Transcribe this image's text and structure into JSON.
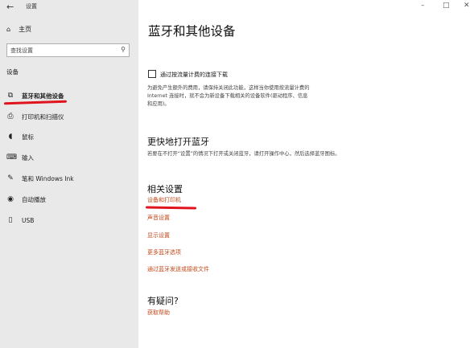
{
  "titlebar": {
    "back_icon": "back-arrow-icon",
    "title": "设置",
    "minimize": "–",
    "maximize": "□",
    "close": "✕"
  },
  "sidebar": {
    "home_label": "主页",
    "search_placeholder": "查找设置",
    "section_label": "设备",
    "items": [
      {
        "label": "蓝牙和其他设备",
        "icon": "bluetooth-devices-icon",
        "selected": true
      },
      {
        "label": "打印机和扫描仪",
        "icon": "printer-icon"
      },
      {
        "label": "鼠标",
        "icon": "mouse-icon"
      },
      {
        "label": "输入",
        "icon": "keyboard-icon"
      },
      {
        "label": "笔和 Windows Ink",
        "icon": "pen-icon"
      },
      {
        "label": "自动播放",
        "icon": "autoplay-icon"
      },
      {
        "label": "USB",
        "icon": "usb-icon"
      }
    ]
  },
  "main": {
    "title": "蓝牙和其他设备",
    "metered_checkbox_label": "通过按流量计费的连接下载",
    "metered_checked": false,
    "metered_desc_lines": [
      "为避免产生额外的费用，请保持关闭此功能，这样当你使用按流量计费的",
      "Internet 连接时，就不会为新设备下载相关的设备软件(驱动程序、信息",
      "和应用)。"
    ],
    "quick_heading": "更快地打开蓝牙",
    "quick_desc": "若要在不打开“设置”的情况下打开或关闭蓝牙，请打开操作中心，然后选择蓝牙图标。",
    "related_heading": "相关设置",
    "related_links": [
      "设备和打印机",
      "声音设置",
      "显示设置",
      "更多蓝牙选项",
      "通过蓝牙发送或接收文件"
    ],
    "help_heading": "有疑问?",
    "help_link": "获取帮助"
  },
  "colors": {
    "link": "#c44a1c",
    "annotation": "#e0141e",
    "sidebar_bg": "#e9e9e9"
  }
}
